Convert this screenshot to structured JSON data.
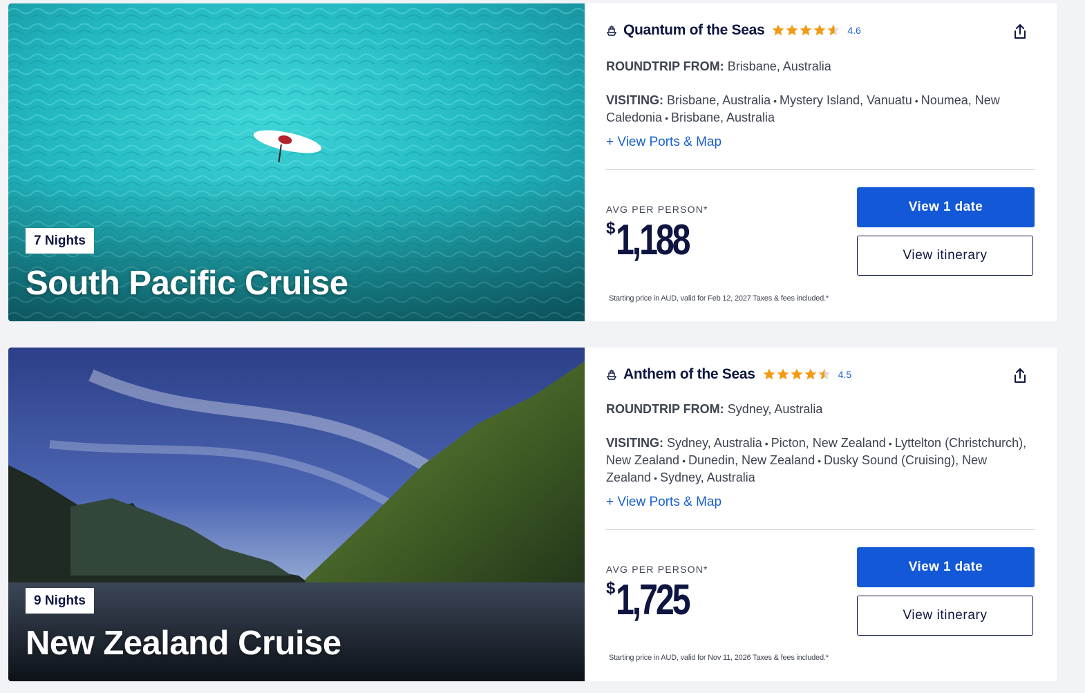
{
  "colors": {
    "brand_navy": "#0e1540",
    "link_blue": "#1a5fd0",
    "button_blue": "#1358d7",
    "star_gold": "#f29a12",
    "page_bg": "#f2f3f6"
  },
  "cruises": [
    {
      "nights": "7 Nights",
      "title": "South Pacific Cruise",
      "image": "aerial-turquoise-sea-paddleboard",
      "ship_icon": "ship-icon",
      "ship": "Quantum of the Seas",
      "rating": "4.6",
      "stars_value": 4.6,
      "share_icon": "share-icon",
      "roundtrip_label": "ROUNDTRIP FROM:",
      "roundtrip_value": "Brisbane, Australia",
      "visiting_label": "VISITING:",
      "ports": [
        "Brisbane, Australia",
        "Mystery Island, Vanuatu",
        "Noumea, New Caledonia",
        "Brisbane, Australia"
      ],
      "ports_link": "+ View Ports & Map",
      "avg_label": "AVG PER PERSON*",
      "currency_symbol": "$",
      "price": "1,188",
      "disclaimer": "Starting price in AUD, valid for Feb 12, 2027 Taxes & fees included.*",
      "primary_button": "View 1 date",
      "secondary_button": "View itinerary"
    },
    {
      "nights": "9 Nights",
      "title": "New Zealand Cruise",
      "image": "fjord-mountains-blue-sky",
      "ship_icon": "ship-icon",
      "ship": "Anthem of the Seas",
      "rating": "4.5",
      "stars_value": 4.5,
      "share_icon": "share-icon",
      "roundtrip_label": "ROUNDTRIP FROM:",
      "roundtrip_value": "Sydney, Australia",
      "visiting_label": "VISITING:",
      "ports": [
        "Sydney, Australia",
        "Picton, New Zealand",
        "Lyttelton (Christchurch), New Zealand",
        "Dunedin, New Zealand",
        "Dusky Sound (Cruising), New Zealand",
        "Sydney, Australia"
      ],
      "ports_link": "+ View Ports & Map",
      "avg_label": "AVG PER PERSON*",
      "currency_symbol": "$",
      "price": "1,725",
      "disclaimer": "Starting price in AUD, valid for Nov 11, 2026 Taxes & fees included.*",
      "primary_button": "View 1 date",
      "secondary_button": "View itinerary"
    }
  ]
}
